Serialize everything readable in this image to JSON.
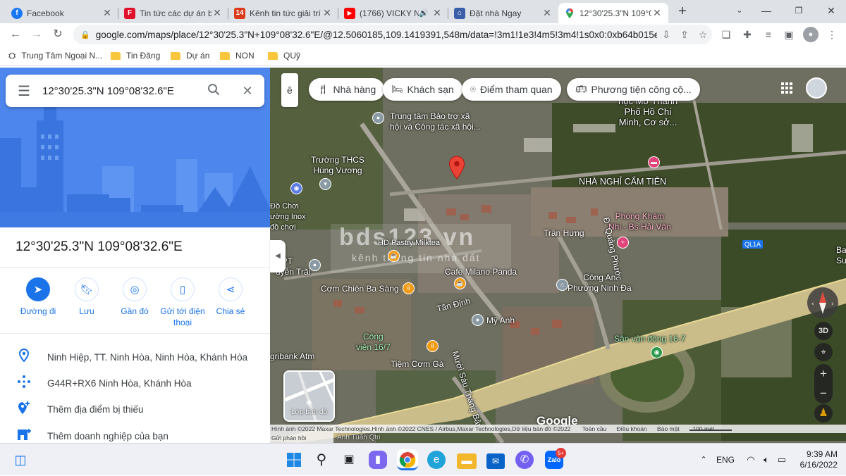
{
  "browser": {
    "tabs": [
      {
        "title": "Facebook",
        "favicon": "facebook-icon",
        "color": "#1877f2",
        "active": false
      },
      {
        "title": "Tin tức các dự án bất",
        "favicon": "news-icon",
        "color": "#e0102a",
        "active": false
      },
      {
        "title": "Kênh tin tức giải trí",
        "favicon": "14-icon",
        "color": "#d93a1a",
        "active": false
      },
      {
        "title": "(1766) VICKY N",
        "favicon": "youtube-icon",
        "color": "#ff0000",
        "active": false
      },
      {
        "title": "Đặt nhà Ngay",
        "favicon": "ban-icon",
        "color": "#3b5ea8",
        "active": false
      },
      {
        "title": "12°30'25.3\"N 109°0",
        "favicon": "maps-icon",
        "color": "#34a853",
        "active": true
      }
    ],
    "new_tab_label": "+",
    "url": "google.com/maps/place/12°30'25.3\"N+109°08'32.6\"E/@12.5060185,109.1419391,548m/data=!3m1!1e3!4m5!3m4!1s0x0:0xb64b015e...",
    "bookmarks": [
      {
        "label": "Trung Tâm Ngoại N...",
        "type": "site"
      },
      {
        "label": "Tin Đăng",
        "type": "folder"
      },
      {
        "label": "Dự án",
        "type": "folder"
      },
      {
        "label": "NON",
        "type": "folder"
      },
      {
        "label": "QUỹ",
        "type": "folder"
      }
    ]
  },
  "panel": {
    "search_value": "12°30'25.3\"N 109°08'32.6\"E",
    "place_title": "12°30'25.3\"N 109°08'32.6\"E",
    "actions": [
      {
        "label": "Đường đi",
        "icon": "directions-icon"
      },
      {
        "label": "Lưu",
        "icon": "bookmark-icon"
      },
      {
        "label": "Gần đó",
        "icon": "nearby-icon"
      },
      {
        "label": "Gửi tới điện thoại",
        "icon": "send-to-phone-icon"
      },
      {
        "label": "Chia sẻ",
        "icon": "share-icon"
      }
    ],
    "info": [
      {
        "text": "Ninh Hiệp, TT. Ninh Hòa, Ninh Hòa, Khánh Hòa",
        "icon": "location-pin-icon"
      },
      {
        "text": "G44R+RX6 Ninh Hòa, Khánh Hòa",
        "icon": "plus-code-icon"
      },
      {
        "text": "Thêm địa điểm bị thiếu",
        "icon": "add-place-icon"
      },
      {
        "text": "Thêm doanh nghiệp của bạn",
        "icon": "add-business-icon"
      }
    ]
  },
  "map": {
    "chips": [
      {
        "label": "Nhà hàng",
        "icon": "restaurant-icon"
      },
      {
        "label": "Khách sạn",
        "icon": "hotel-icon"
      },
      {
        "label": "Điểm tham quan",
        "icon": "attraction-icon"
      },
      {
        "label": "Phương tiện công cộ...",
        "icon": "transit-icon"
      }
    ],
    "chip_partial": "ê",
    "labels": {
      "trung_tam": "Trung tâm Bảo trợ xã\nhội và Công tác xã hội...",
      "hoc_mo": "học Mở Thành\nPhố Hồ Chí\nMinh, Cơ sở...",
      "thcs": "Trường THCS\nHùng Vương",
      "nha_nghi": "NHÀ NGHỈ CẨM TIÊN",
      "do_choi": "Đồ Chơi\nường Inox\nđồ chơi",
      "phong_kham": "Phòng Khám\nNhi - Bs Hải Vân",
      "tran_hung": "Trần Hưng",
      "quang_phuoc": "Đ. Quảng Phước",
      "ql1a": "QL1A",
      "ban": "Ban\nSư",
      "hd_pastry": "HD Pastry Milktea",
      "hpt": "HPT\nuyễn Trãi",
      "milano": "Cafe Milano Panda",
      "ba_sang": "Cơm Chiên Ba Sàng",
      "cong_an": "Công An\nPhường Ninh Đa",
      "tan_dinh": "Tân Định",
      "my_anh": "Mỹ Anh",
      "cong_vien": "Công\nviên 16/7",
      "san_van_dong": "Sân vận động 16-7",
      "agribank": "gribank Atm",
      "com_ga": "Tiệm Cơm Gà",
      "muoi_sau": "Mười Sáu Tháng Bảy",
      "anh_tuan": "Anh Tuấn Qtri"
    },
    "layer_label": "Lớp bản đồ",
    "google_logo": "Google",
    "btn_3d": "3D",
    "footer": {
      "attribution": "Hình ảnh ©2022 Maxar Technologies,Hình ảnh ©2022 CNES / Airbus,Maxar Technologies,Dữ liệu bản đồ ©2022",
      "terms": "Toàn cầu",
      "terms2": "Điều khoản",
      "privacy": "Bảo mật",
      "scale": "100 mét",
      "feedback": "Gửi phản hồi"
    },
    "watermark_main": "bds123.vn",
    "watermark_sub": "kênh thông tin nhà đất"
  },
  "taskbar": {
    "lang": "ENG",
    "time": "9:39 AM",
    "date": "6/16/2022",
    "badge": "5+"
  }
}
